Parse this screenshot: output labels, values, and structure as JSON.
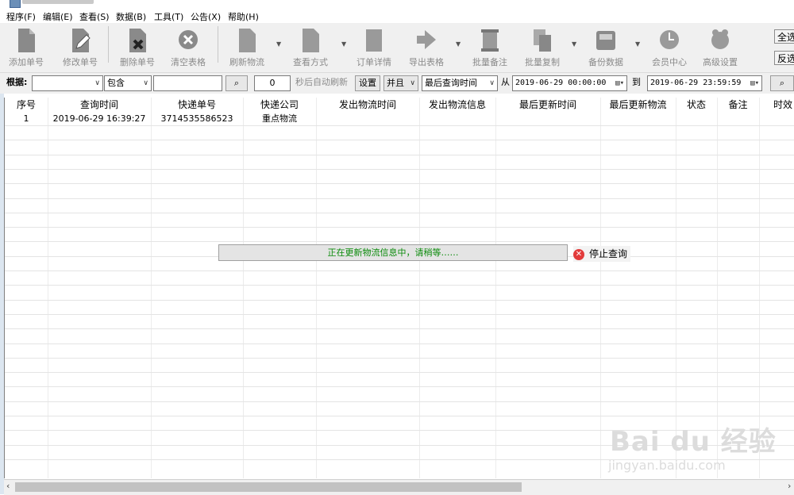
{
  "menu": [
    {
      "label": "程序(F)"
    },
    {
      "label": "编辑(E)"
    },
    {
      "label": "查看(S)"
    },
    {
      "label": "数据(B)"
    },
    {
      "label": "工具(T)"
    },
    {
      "label": "公告(X)"
    },
    {
      "label": "帮助(H)"
    }
  ],
  "toolbar": {
    "add": "添加单号",
    "edit": "修改单号",
    "delete": "删除单号",
    "clear": "清空表格",
    "refresh": "刷新物流",
    "view_mode": "查看方式",
    "order_detail": "订单详情",
    "export": "导出表格",
    "batch_note": "批量备注",
    "batch_copy": "批量复制",
    "backup": "备份数据",
    "member": "会员中心",
    "advanced": "高级设置",
    "select_all": "全选",
    "invert": "反选"
  },
  "filter": {
    "basis_label": "根据:",
    "basis_value": "",
    "match_value": "包含",
    "keyword": "",
    "interval": "0",
    "auto_refresh_label": "秒后自动刷新",
    "settings": "设置",
    "logic": "并且",
    "field": "最后查询时间",
    "from_label": "从",
    "from_date": "2019-06-29 00:00:00",
    "to_label": "到",
    "to_date": "2019-06-29 23:59:59"
  },
  "table": {
    "columns": [
      "序号",
      "查询时间",
      "快递单号",
      "快递公司",
      "发出物流时间",
      "发出物流信息",
      "最后更新时间",
      "最后更新物流",
      "状态",
      "备注",
      "时效"
    ],
    "rows": [
      [
        "1",
        "2019-06-29 16:39:27",
        "3714535586523",
        "重点物流",
        "",
        "",
        "",
        "",
        "",
        "",
        ""
      ]
    ]
  },
  "status": {
    "progress_text": "正在更新物流信息中，请稍等……",
    "stop_label": "停止查询"
  },
  "watermark": {
    "main": "Bai du 经验",
    "sub": "jingyan.baidu.com"
  },
  "icons": {
    "stop": "close-circle-icon",
    "search": "magnifier-icon",
    "calendar": "calendar-icon"
  }
}
